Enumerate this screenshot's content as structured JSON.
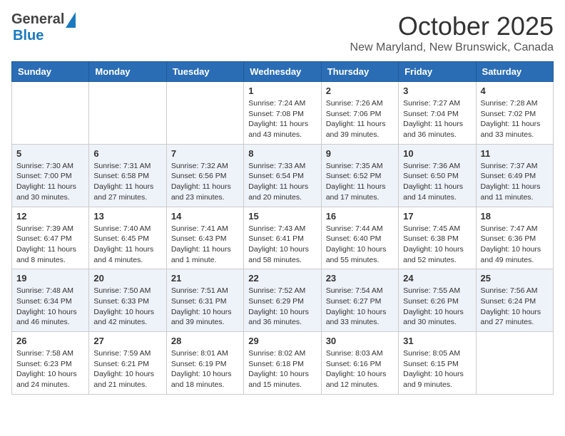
{
  "logo": {
    "general": "General",
    "blue": "Blue"
  },
  "header": {
    "month": "October 2025",
    "location": "New Maryland, New Brunswick, Canada"
  },
  "weekdays": [
    "Sunday",
    "Monday",
    "Tuesday",
    "Wednesday",
    "Thursday",
    "Friday",
    "Saturday"
  ],
  "weeks": [
    [
      {
        "day": "",
        "sunrise": "",
        "sunset": "",
        "daylight": ""
      },
      {
        "day": "",
        "sunrise": "",
        "sunset": "",
        "daylight": ""
      },
      {
        "day": "",
        "sunrise": "",
        "sunset": "",
        "daylight": ""
      },
      {
        "day": "1",
        "sunrise": "Sunrise: 7:24 AM",
        "sunset": "Sunset: 7:08 PM",
        "daylight": "Daylight: 11 hours and 43 minutes."
      },
      {
        "day": "2",
        "sunrise": "Sunrise: 7:26 AM",
        "sunset": "Sunset: 7:06 PM",
        "daylight": "Daylight: 11 hours and 39 minutes."
      },
      {
        "day": "3",
        "sunrise": "Sunrise: 7:27 AM",
        "sunset": "Sunset: 7:04 PM",
        "daylight": "Daylight: 11 hours and 36 minutes."
      },
      {
        "day": "4",
        "sunrise": "Sunrise: 7:28 AM",
        "sunset": "Sunset: 7:02 PM",
        "daylight": "Daylight: 11 hours and 33 minutes."
      }
    ],
    [
      {
        "day": "5",
        "sunrise": "Sunrise: 7:30 AM",
        "sunset": "Sunset: 7:00 PM",
        "daylight": "Daylight: 11 hours and 30 minutes."
      },
      {
        "day": "6",
        "sunrise": "Sunrise: 7:31 AM",
        "sunset": "Sunset: 6:58 PM",
        "daylight": "Daylight: 11 hours and 27 minutes."
      },
      {
        "day": "7",
        "sunrise": "Sunrise: 7:32 AM",
        "sunset": "Sunset: 6:56 PM",
        "daylight": "Daylight: 11 hours and 23 minutes."
      },
      {
        "day": "8",
        "sunrise": "Sunrise: 7:33 AM",
        "sunset": "Sunset: 6:54 PM",
        "daylight": "Daylight: 11 hours and 20 minutes."
      },
      {
        "day": "9",
        "sunrise": "Sunrise: 7:35 AM",
        "sunset": "Sunset: 6:52 PM",
        "daylight": "Daylight: 11 hours and 17 minutes."
      },
      {
        "day": "10",
        "sunrise": "Sunrise: 7:36 AM",
        "sunset": "Sunset: 6:50 PM",
        "daylight": "Daylight: 11 hours and 14 minutes."
      },
      {
        "day": "11",
        "sunrise": "Sunrise: 7:37 AM",
        "sunset": "Sunset: 6:49 PM",
        "daylight": "Daylight: 11 hours and 11 minutes."
      }
    ],
    [
      {
        "day": "12",
        "sunrise": "Sunrise: 7:39 AM",
        "sunset": "Sunset: 6:47 PM",
        "daylight": "Daylight: 11 hours and 8 minutes."
      },
      {
        "day": "13",
        "sunrise": "Sunrise: 7:40 AM",
        "sunset": "Sunset: 6:45 PM",
        "daylight": "Daylight: 11 hours and 4 minutes."
      },
      {
        "day": "14",
        "sunrise": "Sunrise: 7:41 AM",
        "sunset": "Sunset: 6:43 PM",
        "daylight": "Daylight: 11 hours and 1 minute."
      },
      {
        "day": "15",
        "sunrise": "Sunrise: 7:43 AM",
        "sunset": "Sunset: 6:41 PM",
        "daylight": "Daylight: 10 hours and 58 minutes."
      },
      {
        "day": "16",
        "sunrise": "Sunrise: 7:44 AM",
        "sunset": "Sunset: 6:40 PM",
        "daylight": "Daylight: 10 hours and 55 minutes."
      },
      {
        "day": "17",
        "sunrise": "Sunrise: 7:45 AM",
        "sunset": "Sunset: 6:38 PM",
        "daylight": "Daylight: 10 hours and 52 minutes."
      },
      {
        "day": "18",
        "sunrise": "Sunrise: 7:47 AM",
        "sunset": "Sunset: 6:36 PM",
        "daylight": "Daylight: 10 hours and 49 minutes."
      }
    ],
    [
      {
        "day": "19",
        "sunrise": "Sunrise: 7:48 AM",
        "sunset": "Sunset: 6:34 PM",
        "daylight": "Daylight: 10 hours and 46 minutes."
      },
      {
        "day": "20",
        "sunrise": "Sunrise: 7:50 AM",
        "sunset": "Sunset: 6:33 PM",
        "daylight": "Daylight: 10 hours and 42 minutes."
      },
      {
        "day": "21",
        "sunrise": "Sunrise: 7:51 AM",
        "sunset": "Sunset: 6:31 PM",
        "daylight": "Daylight: 10 hours and 39 minutes."
      },
      {
        "day": "22",
        "sunrise": "Sunrise: 7:52 AM",
        "sunset": "Sunset: 6:29 PM",
        "daylight": "Daylight: 10 hours and 36 minutes."
      },
      {
        "day": "23",
        "sunrise": "Sunrise: 7:54 AM",
        "sunset": "Sunset: 6:27 PM",
        "daylight": "Daylight: 10 hours and 33 minutes."
      },
      {
        "day": "24",
        "sunrise": "Sunrise: 7:55 AM",
        "sunset": "Sunset: 6:26 PM",
        "daylight": "Daylight: 10 hours and 30 minutes."
      },
      {
        "day": "25",
        "sunrise": "Sunrise: 7:56 AM",
        "sunset": "Sunset: 6:24 PM",
        "daylight": "Daylight: 10 hours and 27 minutes."
      }
    ],
    [
      {
        "day": "26",
        "sunrise": "Sunrise: 7:58 AM",
        "sunset": "Sunset: 6:23 PM",
        "daylight": "Daylight: 10 hours and 24 minutes."
      },
      {
        "day": "27",
        "sunrise": "Sunrise: 7:59 AM",
        "sunset": "Sunset: 6:21 PM",
        "daylight": "Daylight: 10 hours and 21 minutes."
      },
      {
        "day": "28",
        "sunrise": "Sunrise: 8:01 AM",
        "sunset": "Sunset: 6:19 PM",
        "daylight": "Daylight: 10 hours and 18 minutes."
      },
      {
        "day": "29",
        "sunrise": "Sunrise: 8:02 AM",
        "sunset": "Sunset: 6:18 PM",
        "daylight": "Daylight: 10 hours and 15 minutes."
      },
      {
        "day": "30",
        "sunrise": "Sunrise: 8:03 AM",
        "sunset": "Sunset: 6:16 PM",
        "daylight": "Daylight: 10 hours and 12 minutes."
      },
      {
        "day": "31",
        "sunrise": "Sunrise: 8:05 AM",
        "sunset": "Sunset: 6:15 PM",
        "daylight": "Daylight: 10 hours and 9 minutes."
      },
      {
        "day": "",
        "sunrise": "",
        "sunset": "",
        "daylight": ""
      }
    ]
  ]
}
